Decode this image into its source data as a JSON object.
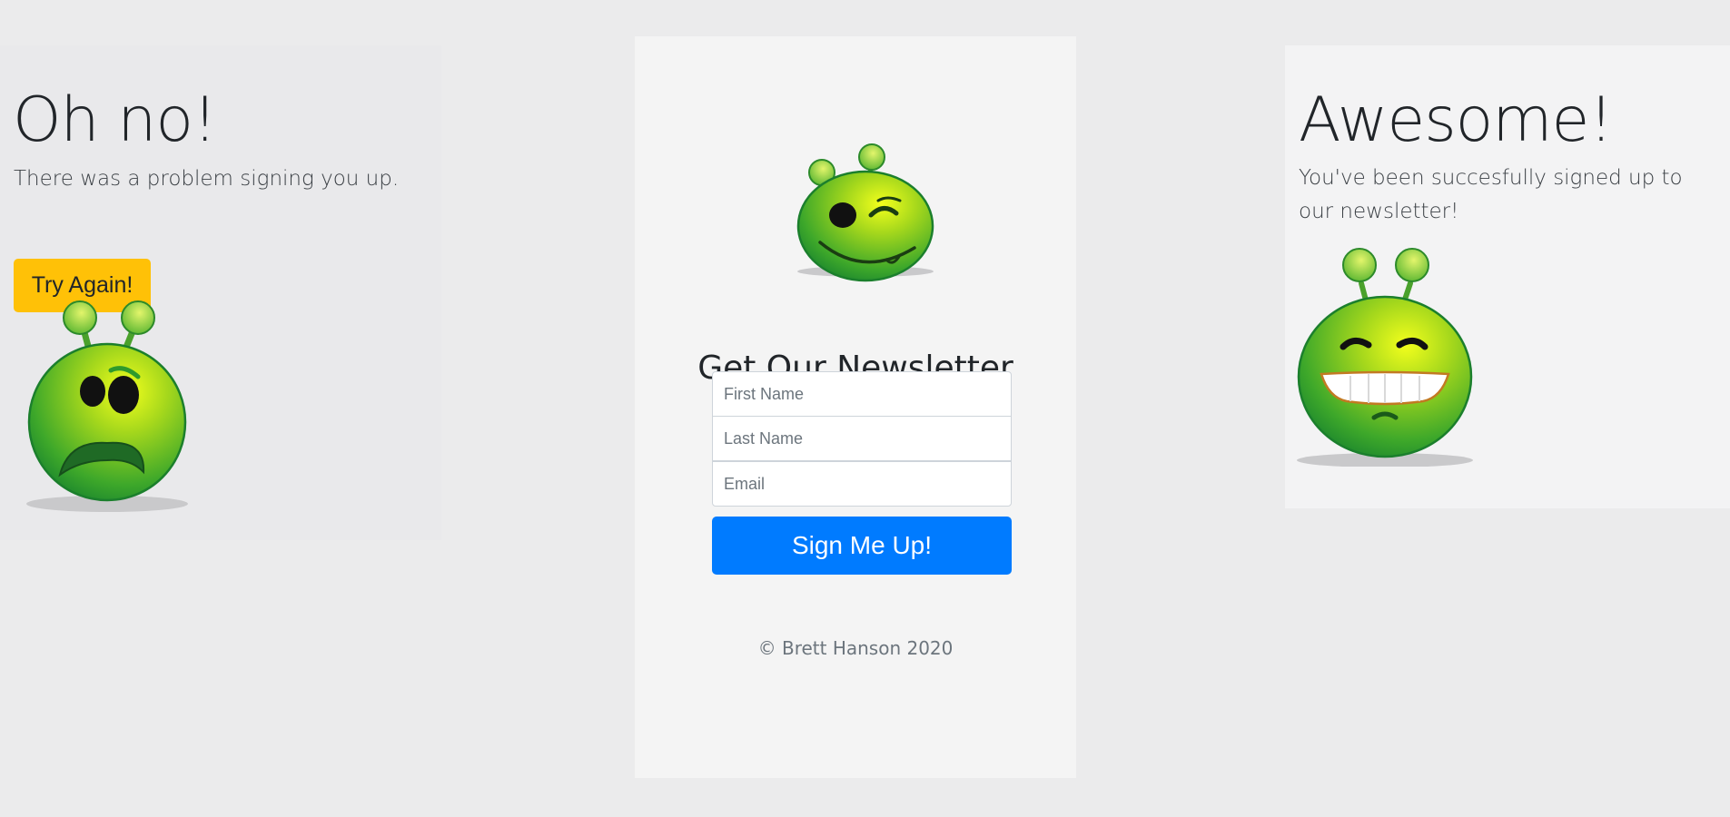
{
  "failure": {
    "heading": "Oh no!",
    "message": "There was a problem signing you up.",
    "button_label": "Try Again!",
    "button_color": "#ffc107"
  },
  "signup": {
    "title": "Get Our Newsletter",
    "first_name_placeholder": "First Name",
    "last_name_placeholder": "Last Name",
    "email_placeholder": "Email",
    "submit_label": "Sign Me Up!",
    "submit_color": "#007bff",
    "footer": "© Brett Hanson 2020"
  },
  "success": {
    "heading": "Awesome!",
    "message": "You've been succesfully signed up to our newsletter!"
  },
  "icons": {
    "failure_image": "worried-alien-icon",
    "signup_image": "winking-alien-icon",
    "success_image": "grinning-alien-icon"
  }
}
